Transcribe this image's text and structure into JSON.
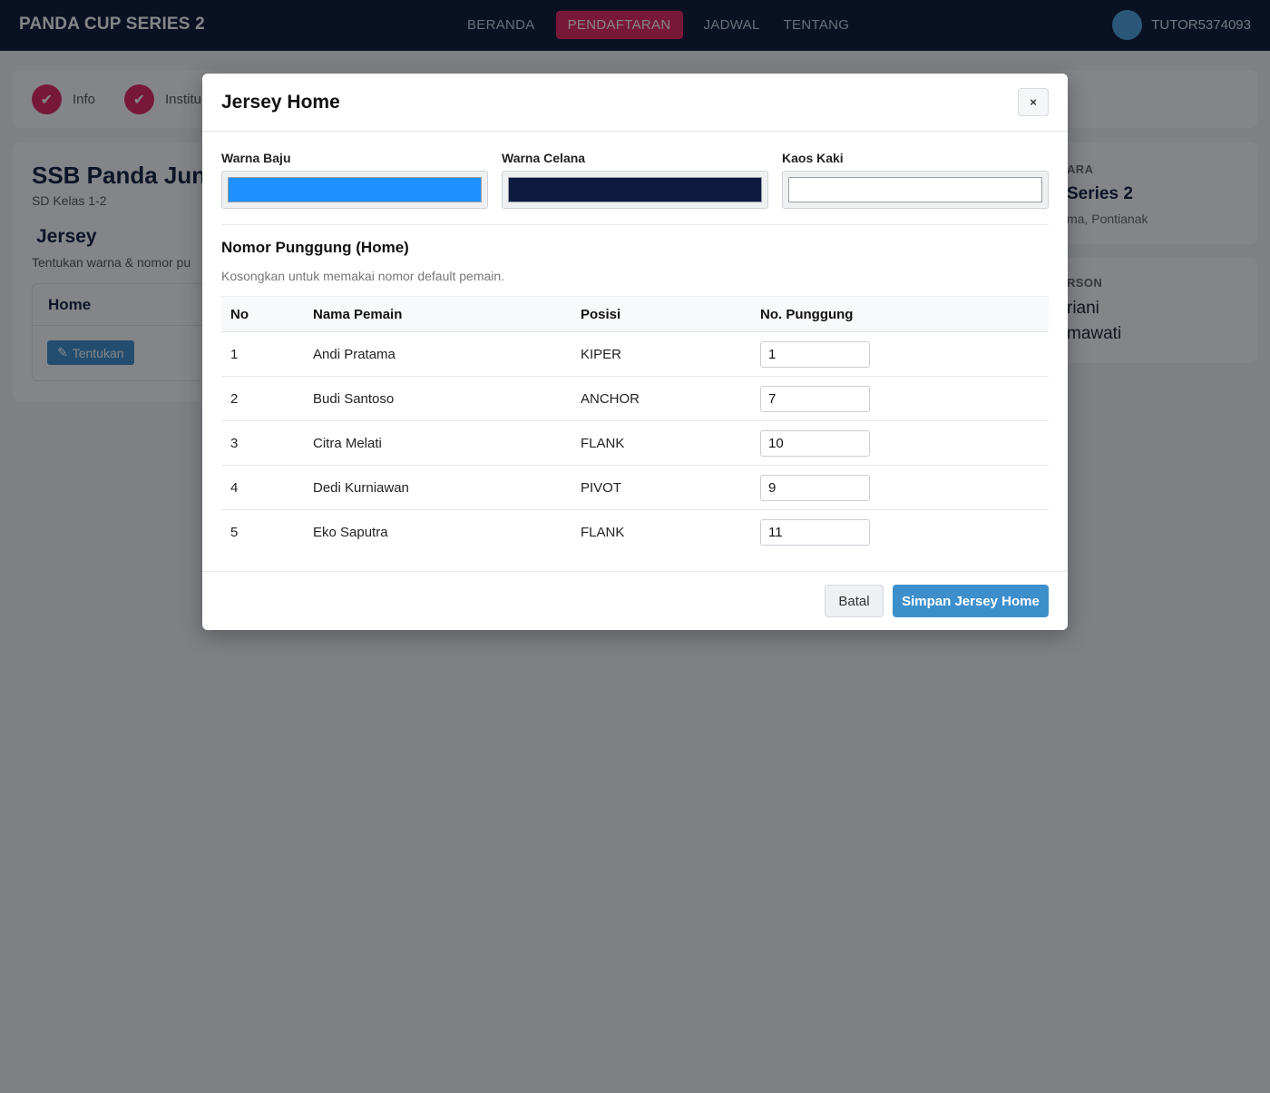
{
  "navbar": {
    "brand": "PANDA CUP SERIES 2",
    "links": [
      "BERANDA",
      "PENDAFTARAN",
      "JADWAL",
      "TENTANG"
    ],
    "active_link": "PENDAFTARAN",
    "username": "TUTOR5374093"
  },
  "steps": [
    {
      "label": "Info"
    },
    {
      "label": "Institu"
    }
  ],
  "team": {
    "name": "SSB Panda Jun",
    "class": "SD Kelas 1-2"
  },
  "jersey_section": {
    "title": "Jersey",
    "subtitle": "Tentukan warna & nomor pu",
    "home_label": "Home",
    "button_label": "Tentukan"
  },
  "sidebar": {
    "event_label": "ARA",
    "event_name": "Series 2",
    "event_location": "ma, Pontianak",
    "contact_label": "RSON",
    "contact_1": "riani",
    "contact_2": "mawati"
  },
  "modal": {
    "title": "Jersey Home",
    "close_label": "×",
    "colors": [
      {
        "label": "Warna Baju",
        "value": "#1e90ff"
      },
      {
        "label": "Warna Celana",
        "value": "#0b1a3d"
      },
      {
        "label": "Kaos Kaki",
        "value": "#ffffff"
      }
    ],
    "numbers_title": "Nomor Punggung (Home)",
    "numbers_hint": "Kosongkan untuk memakai nomor default pemain.",
    "table": {
      "headers": [
        "No",
        "Nama Pemain",
        "Posisi",
        "No. Punggung"
      ],
      "rows": [
        {
          "no": "1",
          "name": "Andi Pratama",
          "position": "KIPER",
          "number": "1"
        },
        {
          "no": "2",
          "name": "Budi Santoso",
          "position": "ANCHOR",
          "number": "7"
        },
        {
          "no": "3",
          "name": "Citra Melati",
          "position": "FLANK",
          "number": "10"
        },
        {
          "no": "4",
          "name": "Dedi Kurniawan",
          "position": "PIVOT",
          "number": "9"
        },
        {
          "no": "5",
          "name": "Eko Saputra",
          "position": "FLANK",
          "number": "11"
        }
      ]
    },
    "cancel_label": "Batal",
    "save_label": "Simpan Jersey Home"
  }
}
